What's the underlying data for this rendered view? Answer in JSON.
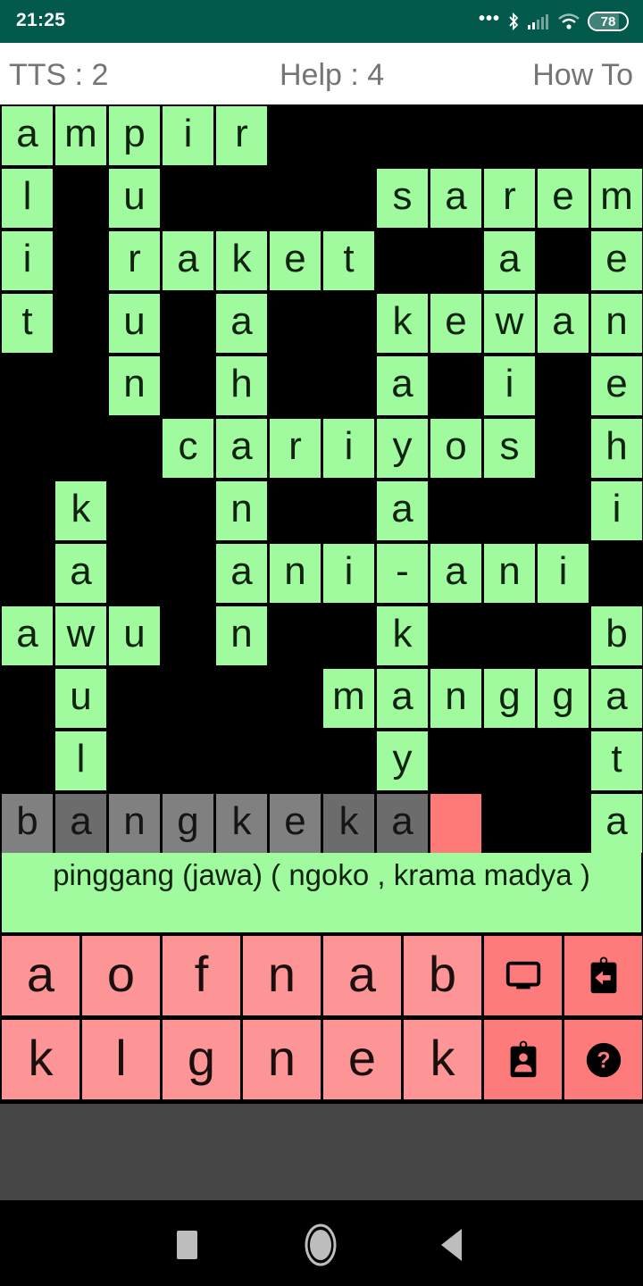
{
  "status_bar": {
    "time": "21:25",
    "icons": [
      "more-dots-icon",
      "bluetooth-icon",
      "signal-icon",
      "wifi-icon",
      "battery-icon"
    ],
    "battery_level": "78"
  },
  "top_bar": {
    "tts_label": "TTS : 2",
    "help_label": "Help : 4",
    "how_to_label": "How To"
  },
  "colors": {
    "status_bar": "#02594c",
    "filled_cell": "#a0fa9e",
    "active_cell": "#808080",
    "active_cross_cell": "#6c6c6c",
    "cursor_cell": "#fe7a79",
    "key": "#fd9597",
    "function_key": "#fd7b7b"
  },
  "puzzle": {
    "columns": 12,
    "rows": 12,
    "grid": [
      [
        "a",
        "m",
        "p",
        "i",
        "r",
        "",
        "",
        "",
        "",
        "",
        "",
        ""
      ],
      [
        "l",
        "",
        "u",
        "",
        "",
        "",
        "",
        "s",
        "a",
        "r",
        "e",
        "m"
      ],
      [
        "i",
        "",
        "r",
        "a",
        "k",
        "e",
        "t",
        "",
        "",
        "a",
        "",
        "e"
      ],
      [
        "t",
        "",
        "u",
        "",
        "a",
        "",
        "",
        "k",
        "e",
        "w",
        "a",
        "n"
      ],
      [
        "",
        "",
        "n",
        "",
        "h",
        "",
        "",
        "a",
        "",
        "i",
        "",
        "e"
      ],
      [
        "",
        "",
        "",
        "c",
        "a",
        "r",
        "i",
        "y",
        "o",
        "s",
        "",
        "h"
      ],
      [
        "",
        "k",
        "",
        "",
        "n",
        "",
        "",
        "a",
        "",
        "",
        "",
        "i"
      ],
      [
        "",
        "a",
        "",
        "",
        "a",
        "n",
        "i",
        "-",
        "a",
        "n",
        "i",
        ""
      ],
      [
        "a",
        "w",
        "u",
        "",
        "n",
        "",
        "",
        "k",
        "",
        "",
        "",
        "b"
      ],
      [
        "",
        "u",
        "",
        "",
        "",
        "",
        "m",
        "a",
        "n",
        "g",
        "g",
        "a"
      ],
      [
        "",
        "l",
        "",
        "",
        "",
        "",
        "",
        "y",
        "",
        "",
        "",
        "t"
      ],
      [
        "b",
        "a",
        "n",
        "g",
        "k",
        "e",
        "k",
        "a",
        "_",
        "",
        "",
        "a"
      ]
    ],
    "active_word": {
      "row": 11,
      "cells": [
        {
          "col": 0,
          "letter": "b",
          "crossing": false
        },
        {
          "col": 1,
          "letter": "a",
          "crossing": true
        },
        {
          "col": 2,
          "letter": "n",
          "crossing": false
        },
        {
          "col": 3,
          "letter": "g",
          "crossing": false
        },
        {
          "col": 4,
          "letter": "k",
          "crossing": false
        },
        {
          "col": 5,
          "letter": "e",
          "crossing": false
        },
        {
          "col": 6,
          "letter": "k",
          "crossing": true
        },
        {
          "col": 7,
          "letter": "a",
          "crossing": true
        },
        {
          "col": 8,
          "letter": "",
          "cursor": true
        }
      ]
    }
  },
  "clue": {
    "text": "pinggang (jawa) ( ngoko , krama madya )"
  },
  "keyboard": {
    "rows": [
      [
        {
          "label": "a",
          "type": "letter"
        },
        {
          "label": "o",
          "type": "letter"
        },
        {
          "label": "f",
          "type": "letter"
        },
        {
          "label": "n",
          "type": "letter"
        },
        {
          "label": "a",
          "type": "letter"
        },
        {
          "label": "b",
          "type": "letter"
        },
        {
          "icon": "monitor-icon",
          "type": "function"
        },
        {
          "icon": "clipboard-back-icon",
          "type": "function"
        }
      ],
      [
        {
          "label": "k",
          "type": "letter"
        },
        {
          "label": "l",
          "type": "letter"
        },
        {
          "label": "g",
          "type": "letter"
        },
        {
          "label": "n",
          "type": "letter"
        },
        {
          "label": "e",
          "type": "letter"
        },
        {
          "label": "k",
          "type": "letter"
        },
        {
          "icon": "contact-badge-icon",
          "type": "function"
        },
        {
          "icon": "help-circle-icon",
          "type": "function"
        }
      ]
    ]
  },
  "nav_bar": {
    "buttons": [
      "recents-icon",
      "home-icon",
      "back-icon"
    ]
  }
}
